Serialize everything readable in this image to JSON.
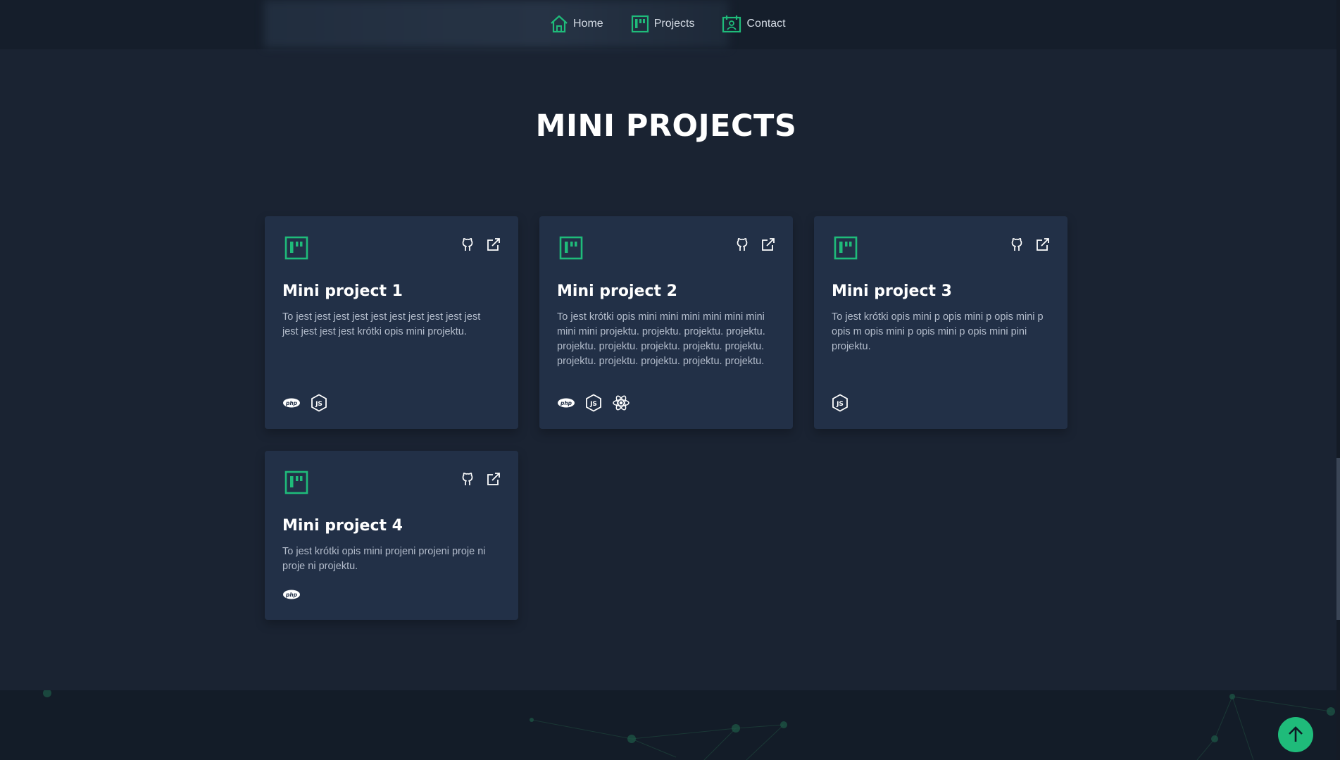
{
  "nav": {
    "links": [
      {
        "label": "Home",
        "icon": "home-icon"
      },
      {
        "label": "Projects",
        "icon": "projects-icon"
      },
      {
        "label": "Contact",
        "icon": "contact-icon"
      }
    ]
  },
  "section": {
    "title": "MINI PROJECTS"
  },
  "projects": [
    {
      "title": "Mini project 1",
      "description": "To jest jest jest jest jest jest jest jest jest jest jest jest jest jest krótki opis mini projektu.",
      "techs": [
        "php-icon",
        "nodejs-icon"
      ]
    },
    {
      "title": "Mini project 2",
      "description": "To jest krótki opis mini mini mini mini mini mini mini mini projektu. projektu. projektu. projektu. projektu. projektu. projektu. projektu. projektu. projektu. projektu. projektu. projektu. projektu.",
      "techs": [
        "php-icon",
        "nodejs-icon",
        "react-icon"
      ]
    },
    {
      "title": "Mini project 3",
      "description": "To jest krótki opis mini p opis mini p opis mini p opis m opis mini p opis mini p opis mini pini projektu.",
      "techs": [
        "nodejs-icon"
      ]
    },
    {
      "title": "Mini project 4",
      "description": "To jest krótki opis mini projeni projeni proje ni proje ni projektu.",
      "techs": [
        "php-icon"
      ]
    }
  ],
  "colors": {
    "accent": "#1fbb7a",
    "background": "#1a2332",
    "card": "#223047"
  }
}
